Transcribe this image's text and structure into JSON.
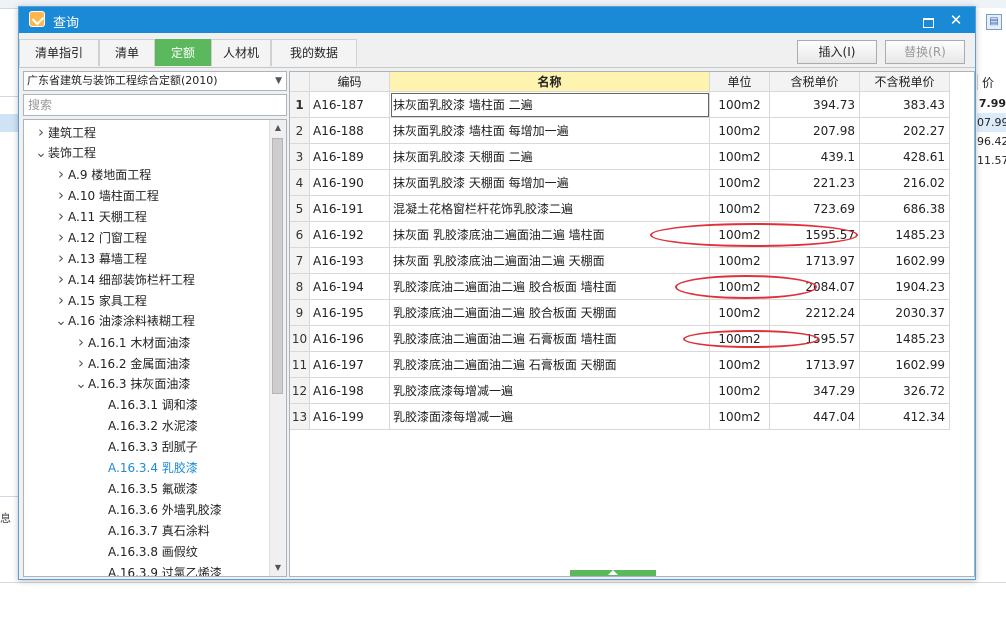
{
  "window": {
    "title": "查询"
  },
  "tabs": [
    {
      "label": "清单指引"
    },
    {
      "label": "清单"
    },
    {
      "label": "定额",
      "active": true
    },
    {
      "label": "人材机"
    },
    {
      "label": "我的数据"
    }
  ],
  "toolbar": {
    "insert_label": "插入(I)",
    "replace_label": "替换(R)"
  },
  "library": {
    "selected": "广东省建筑与装饰工程综合定额(2010)"
  },
  "search": {
    "placeholder": "搜索"
  },
  "tree": [
    {
      "label": "建筑工程",
      "level": 0,
      "toggle": "collapsed"
    },
    {
      "label": "装饰工程",
      "level": 0,
      "toggle": "expanded"
    },
    {
      "label": "A.9 楼地面工程",
      "level": 1,
      "toggle": "collapsed"
    },
    {
      "label": "A.10 墙柱面工程",
      "level": 1,
      "toggle": "collapsed"
    },
    {
      "label": "A.11 天棚工程",
      "level": 1,
      "toggle": "collapsed"
    },
    {
      "label": "A.12 门窗工程",
      "level": 1,
      "toggle": "collapsed"
    },
    {
      "label": "A.13 幕墙工程",
      "level": 1,
      "toggle": "collapsed"
    },
    {
      "label": "A.14 细部装饰栏杆工程",
      "level": 1,
      "toggle": "collapsed"
    },
    {
      "label": "A.15 家具工程",
      "level": 1,
      "toggle": "collapsed"
    },
    {
      "label": "A.16 油漆涂料裱糊工程",
      "level": 1,
      "toggle": "expanded"
    },
    {
      "label": "A.16.1 木材面油漆",
      "level": 2,
      "toggle": "collapsed"
    },
    {
      "label": "A.16.2 金属面油漆",
      "level": 2,
      "toggle": "collapsed"
    },
    {
      "label": "A.16.3 抹灰面油漆",
      "level": 2,
      "toggle": "expanded"
    },
    {
      "label": "A.16.3.1 调和漆",
      "level": 3,
      "toggle": "none"
    },
    {
      "label": "A.16.3.2 水泥漆",
      "level": 3,
      "toggle": "none"
    },
    {
      "label": "A.16.3.3 刮腻子",
      "level": 3,
      "toggle": "none"
    },
    {
      "label": "A.16.3.4 乳胶漆",
      "level": 3,
      "toggle": "none",
      "selected": true
    },
    {
      "label": "A.16.3.5 氟碳漆",
      "level": 3,
      "toggle": "none"
    },
    {
      "label": "A.16.3.6 外墙乳胶漆",
      "level": 3,
      "toggle": "none"
    },
    {
      "label": "A.16.3.7 真石涂料",
      "level": 3,
      "toggle": "none"
    },
    {
      "label": "A.16.3.8 画假纹",
      "level": 3,
      "toggle": "none"
    },
    {
      "label": "A.16.3.9 过氯乙烯漆",
      "level": 3,
      "toggle": "none"
    }
  ],
  "grid": {
    "columns": [
      "编码",
      "名称",
      "单位",
      "含税单价",
      "不含税单价"
    ],
    "rows": [
      {
        "num": "1",
        "code": "A16-187",
        "name": "抹灰面乳胶漆 墙柱面 二遍",
        "unit": "100m2",
        "price_tax": "394.73",
        "price_notax": "383.43"
      },
      {
        "num": "2",
        "code": "A16-188",
        "name": "抹灰面乳胶漆 墙柱面 每增加一遍",
        "unit": "100m2",
        "price_tax": "207.98",
        "price_notax": "202.27"
      },
      {
        "num": "3",
        "code": "A16-189",
        "name": "抹灰面乳胶漆 天棚面 二遍",
        "unit": "100m2",
        "price_tax": "439.1",
        "price_notax": "428.61"
      },
      {
        "num": "4",
        "code": "A16-190",
        "name": "抹灰面乳胶漆 天棚面 每增加一遍",
        "unit": "100m2",
        "price_tax": "221.23",
        "price_notax": "216.02"
      },
      {
        "num": "5",
        "code": "A16-191",
        "name": "混凝土花格窗栏杆花饰乳胶漆二遍",
        "unit": "100m2",
        "price_tax": "723.69",
        "price_notax": "686.38"
      },
      {
        "num": "6",
        "code": "A16-192",
        "name": "抹灰面 乳胶漆底油二遍面油二遍 墙柱面",
        "unit": "100m2",
        "price_tax": "1595.57",
        "price_notax": "1485.23"
      },
      {
        "num": "7",
        "code": "A16-193",
        "name": "抹灰面 乳胶漆底油二遍面油二遍 天棚面",
        "unit": "100m2",
        "price_tax": "1713.97",
        "price_notax": "1602.99"
      },
      {
        "num": "8",
        "code": "A16-194",
        "name": "乳胶漆底油二遍面油二遍 胶合板面 墙柱面",
        "unit": "100m2",
        "price_tax": "2084.07",
        "price_notax": "1904.23"
      },
      {
        "num": "9",
        "code": "A16-195",
        "name": "乳胶漆底油二遍面油二遍 胶合板面 天棚面",
        "unit": "100m2",
        "price_tax": "2212.24",
        "price_notax": "2030.37"
      },
      {
        "num": "10",
        "code": "A16-196",
        "name": "乳胶漆底油二遍面油二遍 石膏板面 墙柱面",
        "unit": "100m2",
        "price_tax": "1595.57",
        "price_notax": "1485.23"
      },
      {
        "num": "11",
        "code": "A16-197",
        "name": "乳胶漆底油二遍面油二遍 石膏板面 天棚面",
        "unit": "100m2",
        "price_tax": "1713.97",
        "price_notax": "1602.99"
      },
      {
        "num": "12",
        "code": "A16-198",
        "name": "乳胶漆底漆每增减一遍",
        "unit": "100m2",
        "price_tax": "347.29",
        "price_notax": "326.72"
      },
      {
        "num": "13",
        "code": "A16-199",
        "name": "乳胶漆面漆每增减一遍",
        "unit": "100m2",
        "price_tax": "447.04",
        "price_notax": "412.34"
      }
    ]
  },
  "background": {
    "right_header": "价",
    "right_values": [
      "7.99",
      "07.99",
      "96.42",
      "11.57"
    ],
    "left_char": "息"
  },
  "colors": {
    "titlebar": "#1b8ad6",
    "active_tab": "#5cb85c",
    "name_header": "#fff3b0",
    "annotation": "#e0303a",
    "selected_tree": "#1b8ad6"
  },
  "icons": {
    "app": "app-logo-icon",
    "minimize": "minimize-icon",
    "close": "close-icon",
    "combo": "chevron-down-icon"
  }
}
